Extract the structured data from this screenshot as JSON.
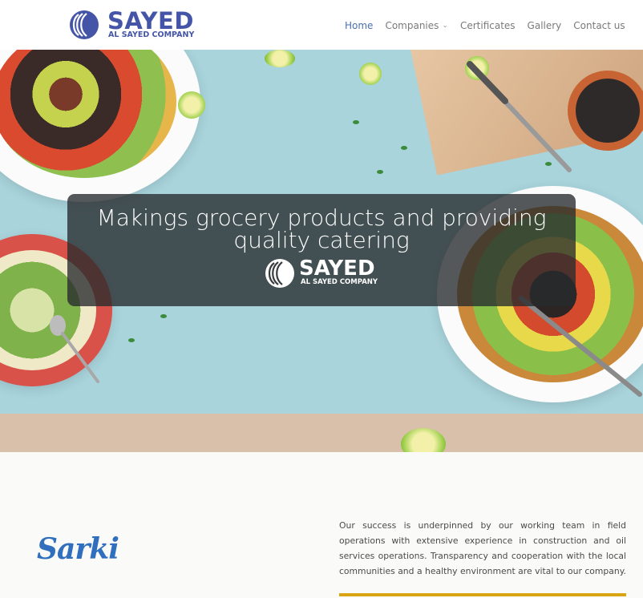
{
  "header": {
    "logo": {
      "word": "SAYED",
      "sub": "AL SAYED COMPANY"
    },
    "nav": [
      {
        "label": "Home",
        "active": true,
        "has_dropdown": false
      },
      {
        "label": "Companies",
        "active": false,
        "has_dropdown": true
      },
      {
        "label": "Certificates",
        "active": false,
        "has_dropdown": false
      },
      {
        "label": "Gallery",
        "active": false,
        "has_dropdown": false
      },
      {
        "label": "Contact us",
        "active": false,
        "has_dropdown": false
      }
    ],
    "accent_color": "#4a6fb0",
    "logo_color": "#4455a8"
  },
  "hero": {
    "title": "Makings grocery products and providing quality catering",
    "logo": {
      "word": "SAYED",
      "sub": "AL SAYED COMPANY"
    }
  },
  "content": {
    "brand_name": "Sarki",
    "brand_color": "#2f6fbd",
    "about_text": "Our success is underpinned by our working team in field operations with extensive experience in construction and oil services operations. Transparency and cooperation with the local communities and a healthy environment are vital to our company.",
    "rule_color": "#d9a512"
  },
  "icons": {
    "dropdown": "chevron-down-icon"
  }
}
